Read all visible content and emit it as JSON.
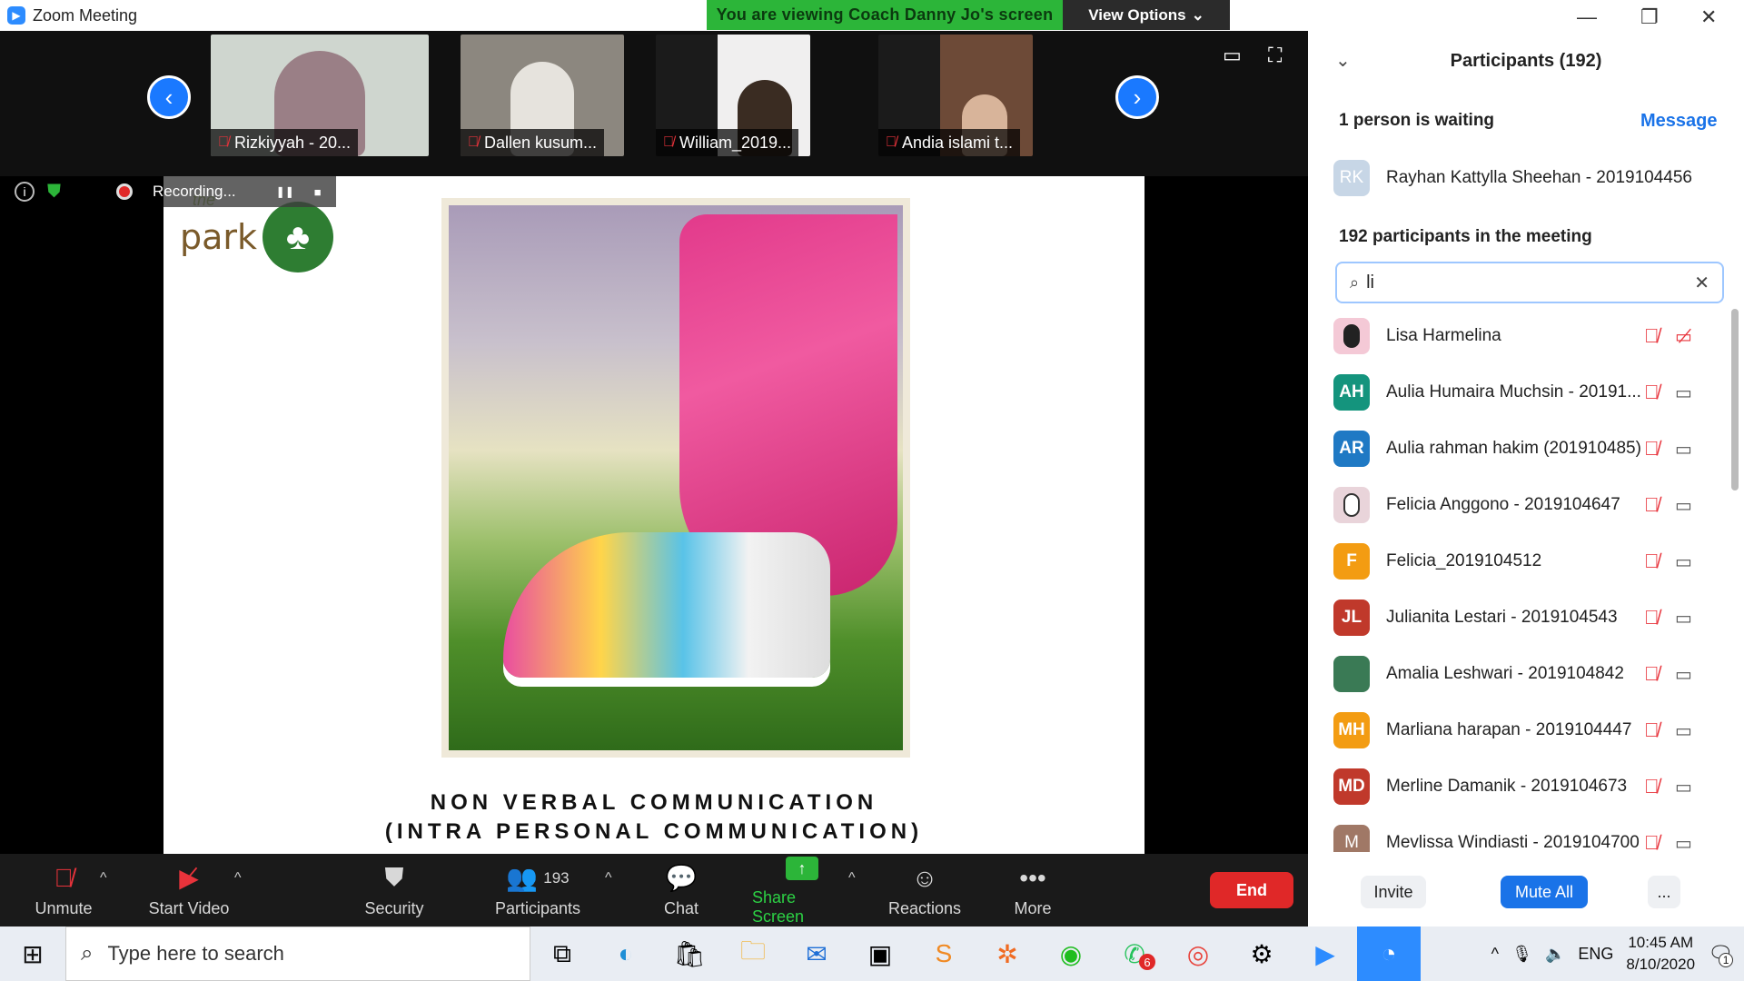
{
  "window": {
    "title": "Zoom Meeting",
    "logo_glyph": "▶"
  },
  "banner": {
    "viewing": "You are viewing Coach Danny Jo's screen",
    "view_options": "View Options"
  },
  "thumbnails": [
    {
      "name": "Rizkiyyah - 20...",
      "bg": "#cfd6cf"
    },
    {
      "name": "Dallen kusum...",
      "bg": "#8c877f"
    },
    {
      "name": "William_2019...",
      "bg": "#f0efef"
    },
    {
      "name": "Andia islami t...",
      "bg": "#6d4a37"
    }
  ],
  "recording": {
    "label": "Recording...",
    "pause": "❚❚",
    "stop": "■"
  },
  "slide": {
    "logo_the": "the",
    "logo_word": "park",
    "caption_line1": "NON VERBAL COMMUNICATION",
    "caption_line2": "(INTRA PERSONAL COMMUNICATION)"
  },
  "toolbar": {
    "unmute": "Unmute",
    "start_video": "Start Video",
    "security": "Security",
    "participants": "Participants",
    "participant_count": "193",
    "chat": "Chat",
    "share_screen": "Share Screen",
    "reactions": "Reactions",
    "more": "More",
    "end": "End"
  },
  "panel": {
    "title": "Participants (192)",
    "waiting_text": "1 person is waiting",
    "message": "Message",
    "waiting_person": {
      "initials": "RK",
      "name": "Rayhan Kattylla Sheehan - 2019104456"
    },
    "in_meeting": "192 participants in the meeting",
    "search_value": "li",
    "participants": [
      {
        "initials": "",
        "name": "Lisa Harmelina",
        "color": "#f4c9d6"
      },
      {
        "initials": "AH",
        "name": "Aulia Humaira Muchsin - 20191...",
        "color": "#14947d"
      },
      {
        "initials": "AR",
        "name": "Aulia rahman hakim (201910485)",
        "color": "#1f79c4"
      },
      {
        "initials": "",
        "name": "Felicia Anggono - 2019104647",
        "color": "#e9d4da"
      },
      {
        "initials": "F",
        "name": "Felicia_2019104512",
        "color": "#f39c12"
      },
      {
        "initials": "JL",
        "name": "Julianita Lestari - 2019104543",
        "color": "#c0392b"
      },
      {
        "initials": "",
        "name": "Amalia Leshwari - 2019104842",
        "color": "#3a7a55"
      },
      {
        "initials": "MH",
        "name": "Marliana harapan - 2019104447",
        "color": "#f39c12"
      },
      {
        "initials": "MD",
        "name": "Merline Damanik - 2019104673",
        "color": "#c0392b"
      },
      {
        "initials": "M",
        "name": "Mevlissa Windiasti - 2019104700",
        "color": "#a07866"
      }
    ],
    "invite": "Invite",
    "mute_all": "Mute All",
    "more": "..."
  },
  "taskbar": {
    "search_placeholder": "Type here to search",
    "language": "ENG",
    "time": "10:45 AM",
    "date": "8/10/2020",
    "whatsapp_badge": "6",
    "notif_badge": "1"
  }
}
